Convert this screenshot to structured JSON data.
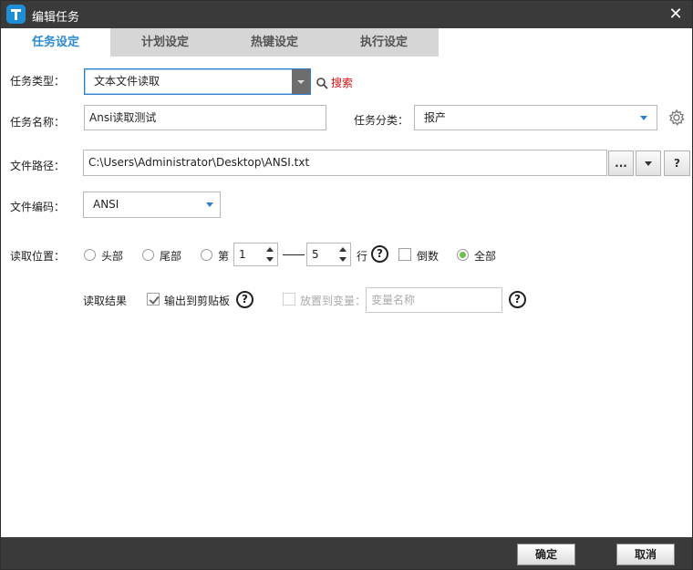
{
  "window": {
    "title": "编辑任务",
    "close_glyph": "✕",
    "app_icon": "T"
  },
  "tabs": [
    {
      "label": "任务设定",
      "active": true
    },
    {
      "label": "计划设定",
      "active": false
    },
    {
      "label": "热键设定",
      "active": false
    },
    {
      "label": "执行设定",
      "active": false
    }
  ],
  "form": {
    "task_type": {
      "label": "任务类型：",
      "value": "文本文件读取",
      "search_label": "搜索"
    },
    "task_name": {
      "label": "任务名称：",
      "value": "Ansi读取测试"
    },
    "task_category": {
      "label": "任务分类：",
      "value": "报产"
    },
    "file_path": {
      "label": "文件路径：",
      "value": "C:\\Users\\Administrator\\Desktop\\ANSI.txt",
      "browse_label": "...",
      "help_label": "?"
    },
    "file_encoding": {
      "label": "文件编码：",
      "value": "ANSI"
    },
    "read_position": {
      "label": "读取位置：",
      "head_label": "头部",
      "tail_label": "尾部",
      "nth_label": "第",
      "from_value": "1",
      "to_value": "5",
      "line_label": "行",
      "reverse_label": "倒数",
      "all_label": "全部",
      "selected": "全部"
    },
    "read_result": {
      "label": "读取结果",
      "clipboard_label": "输出到剪贴板",
      "clipboard_checked": true,
      "variable_label": "放置到变量：",
      "variable_checked": false,
      "variable_placeholder": "变量名称"
    }
  },
  "footer": {
    "ok_label": "确定",
    "cancel_label": "取消"
  },
  "colors": {
    "accent": "#2a8ad4",
    "titlebar": "#3a3a3a",
    "search_link": "#d01010",
    "radio_selected": "#6cc04a"
  }
}
